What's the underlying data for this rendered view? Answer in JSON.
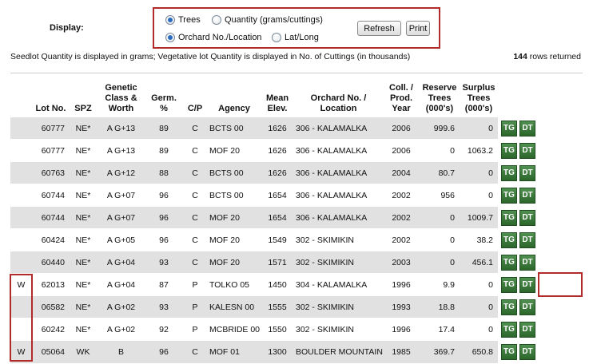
{
  "display_label": "Display:",
  "options": {
    "trees": "Trees",
    "quantity": "Quantity (grams/cuttings)",
    "orchard": "Orchard No./Location",
    "latlong": "Lat/Long"
  },
  "buttons": {
    "refresh": "Refresh",
    "print": "Print"
  },
  "note": "Seedlot Quantity is displayed in grams; Vegetative lot Quantity is displayed in No. of Cuttings (in thousands)",
  "rows_returned": {
    "count": "144",
    "label": "rows returned"
  },
  "headers": {
    "lot": "Lot No.",
    "spz": "SPZ",
    "genetic1": "Genetic",
    "genetic2": "Class &",
    "genetic3": "Worth",
    "germ1": "Germ.",
    "germ2": "%",
    "cp": "C/P",
    "agency": "Agency",
    "elev1": "Mean",
    "elev2": "Elev.",
    "orch1": "Orchard No. /",
    "orch2": "Location",
    "coll1": "Coll. /",
    "coll2": "Prod.",
    "coll3": "Year",
    "res1": "Reserve",
    "res2": "Trees",
    "res3": "(000's)",
    "sur1": "Surplus",
    "sur2": "Trees",
    "sur3": "(000's)"
  },
  "tg_label": "TG",
  "dt_label": "DT",
  "rows": [
    {
      "w": "",
      "lot": "60777",
      "spz": "NE*",
      "gen": "A G+13",
      "germ": "89",
      "cp": "C",
      "agency": "BCTS 00",
      "elev": "1626",
      "orchard": "306 - KALAMALKA",
      "year": "2006",
      "reserve": "999.6",
      "surplus": "0"
    },
    {
      "w": "",
      "lot": "60777",
      "spz": "NE*",
      "gen": "A G+13",
      "germ": "89",
      "cp": "C",
      "agency": "MOF 20",
      "elev": "1626",
      "orchard": "306 - KALAMALKA",
      "year": "2006",
      "reserve": "0",
      "surplus": "1063.2"
    },
    {
      "w": "",
      "lot": "60763",
      "spz": "NE*",
      "gen": "A G+12",
      "germ": "88",
      "cp": "C",
      "agency": "BCTS 00",
      "elev": "1626",
      "orchard": "306 - KALAMALKA",
      "year": "2004",
      "reserve": "80.7",
      "surplus": "0"
    },
    {
      "w": "",
      "lot": "60744",
      "spz": "NE*",
      "gen": "A G+07",
      "germ": "96",
      "cp": "C",
      "agency": "BCTS 00",
      "elev": "1654",
      "orchard": "306 - KALAMALKA",
      "year": "2002",
      "reserve": "956",
      "surplus": "0"
    },
    {
      "w": "",
      "lot": "60744",
      "spz": "NE*",
      "gen": "A G+07",
      "germ": "96",
      "cp": "C",
      "agency": "MOF 20",
      "elev": "1654",
      "orchard": "306 - KALAMALKA",
      "year": "2002",
      "reserve": "0",
      "surplus": "1009.7"
    },
    {
      "w": "",
      "lot": "60424",
      "spz": "NE*",
      "gen": "A G+05",
      "germ": "96",
      "cp": "C",
      "agency": "MOF 20",
      "elev": "1549",
      "orchard": "302 - SKIMIKIN",
      "year": "2002",
      "reserve": "0",
      "surplus": "38.2"
    },
    {
      "w": "",
      "lot": "60440",
      "spz": "NE*",
      "gen": "A G+04",
      "germ": "93",
      "cp": "C",
      "agency": "MOF 20",
      "elev": "1571",
      "orchard": "302 - SKIMIKIN",
      "year": "2003",
      "reserve": "0",
      "surplus": "456.1"
    },
    {
      "w": "W",
      "lot": "62013",
      "spz": "NE*",
      "gen": "A G+04",
      "germ": "87",
      "cp": "P",
      "agency": "TOLKO 05",
      "elev": "1450",
      "orchard": "304 - KALAMALKA",
      "year": "1996",
      "reserve": "9.9",
      "surplus": "0"
    },
    {
      "w": "",
      "lot": "06582",
      "spz": "NE*",
      "gen": "A G+02",
      "germ": "93",
      "cp": "P",
      "agency": "KALESN 00",
      "elev": "1555",
      "orchard": "302 - SKIMIKIN",
      "year": "1993",
      "reserve": "18.8",
      "surplus": "0"
    },
    {
      "w": "",
      "lot": "60242",
      "spz": "NE*",
      "gen": "A G+02",
      "germ": "92",
      "cp": "P",
      "agency": "MCBRIDE 00",
      "elev": "1550",
      "orchard": "302 - SKIMIKIN",
      "year": "1996",
      "reserve": "17.4",
      "surplus": "0"
    },
    {
      "w": "W",
      "lot": "05064",
      "spz": "WK",
      "gen": "B",
      "germ": "96",
      "cp": "C",
      "agency": "MOF 01",
      "elev": "1300",
      "orchard": "BOULDER MOUNTAIN",
      "year": "1985",
      "reserve": "369.7",
      "surplus": "650.8"
    }
  ]
}
